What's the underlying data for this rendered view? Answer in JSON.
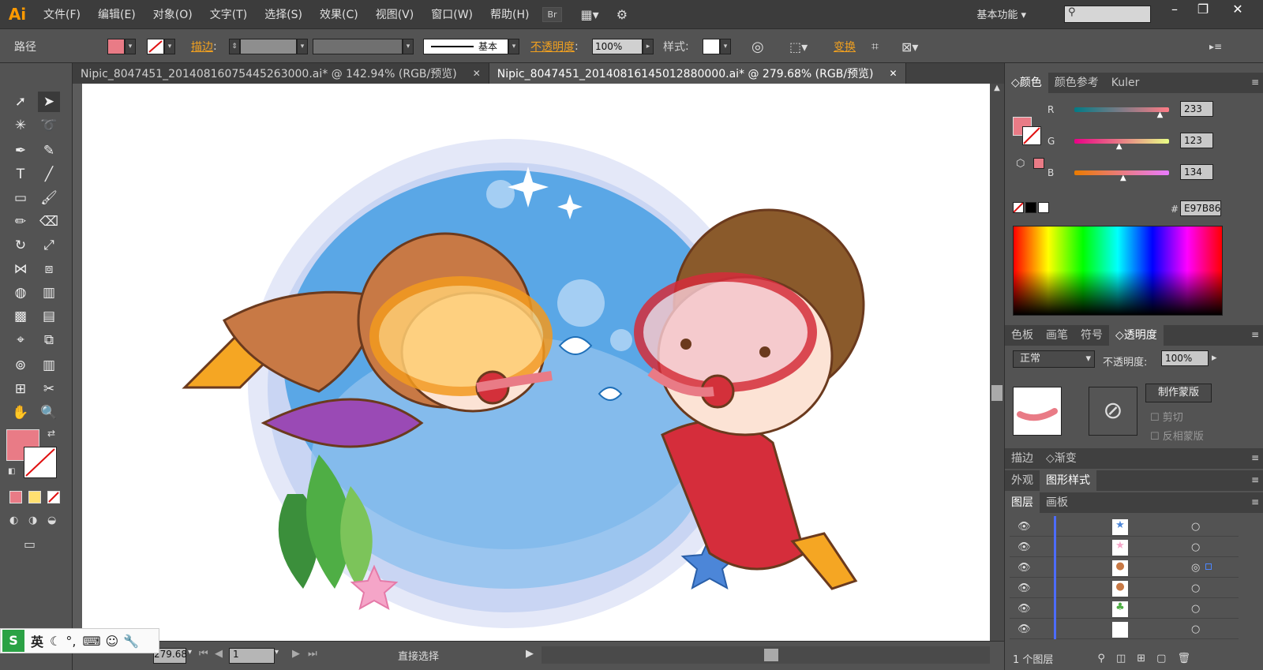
{
  "app": {
    "logo": "Ai",
    "workspace": "基本功能",
    "search_placeholder": ""
  },
  "menu": [
    "文件(F)",
    "编辑(E)",
    "对象(O)",
    "文字(T)",
    "选择(S)",
    "效果(C)",
    "视图(V)",
    "窗口(W)",
    "帮助(H)"
  ],
  "menubar_buttons": {
    "bridge": "Br"
  },
  "control_bar": {
    "object_type": "路径",
    "fill_color": "#E97B86",
    "stroke_label": "描边",
    "stroke_style": "基本",
    "opacity_label": "不透明度",
    "opacity_value": "100%",
    "style_label": "样式",
    "transform_label": "变换"
  },
  "tabs": [
    {
      "label": "Nipic_8047451_20140816075445263000.ai* @ 142.94% (RGB/预览)",
      "active": false
    },
    {
      "label": "Nipic_8047451_20140816145012880000.ai* @ 279.68% (RGB/预览)",
      "active": true
    }
  ],
  "color_panel": {
    "tabs": [
      "颜色",
      "颜色参考",
      "Kuler"
    ],
    "r_label": "R",
    "g_label": "G",
    "b_label": "B",
    "r": "233",
    "g": "123",
    "b": "134",
    "r_fraction": 0.914,
    "g_fraction": 0.482,
    "b_fraction": 0.525,
    "hash_label": "#",
    "hex": "E97B86"
  },
  "transparency_panel": {
    "tabs": [
      "色板",
      "画笔",
      "符号",
      "透明度"
    ],
    "blend_mode": "正常",
    "opacity_label": "不透明度",
    "opacity_value": "100%",
    "make_mask": "制作蒙版",
    "clip": "剪切",
    "invert_mask": "反相蒙版"
  },
  "stroke_gradient_tabs": [
    "描边",
    "渐变"
  ],
  "appearance_tabs": [
    "外观",
    "图形样式"
  ],
  "layers_panel": {
    "tabs": [
      "图层",
      "画板"
    ],
    "footer": "1 个图层"
  },
  "status_bar": {
    "zoom": "279.68",
    "page": "1",
    "tool": "直接选择"
  },
  "ime": {
    "lang": "英"
  }
}
